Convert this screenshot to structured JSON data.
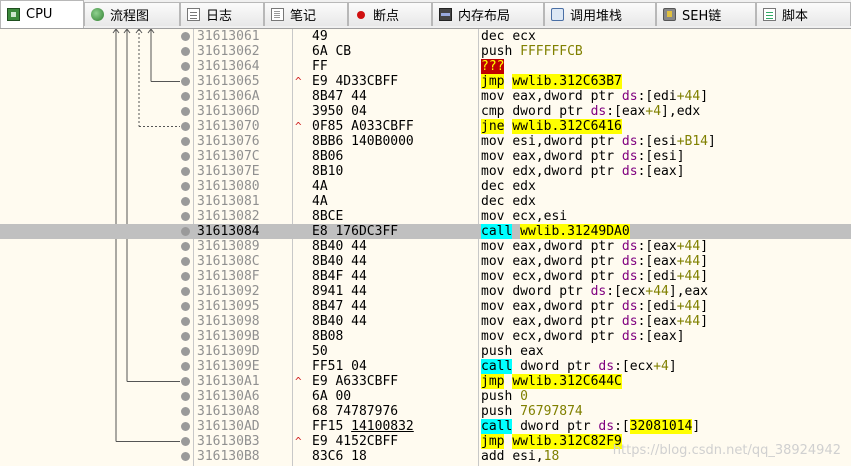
{
  "tabs": [
    {
      "label": "CPU",
      "icon": "cpu-icon",
      "active": true
    },
    {
      "label": "流程图",
      "icon": "flowchart-icon"
    },
    {
      "label": "日志",
      "icon": "log-icon"
    },
    {
      "label": "笔记",
      "icon": "notes-icon"
    },
    {
      "label": "断点",
      "icon": "breakpoint-icon"
    },
    {
      "label": "内存布局",
      "icon": "memory-map-icon"
    },
    {
      "label": "调用堆栈",
      "icon": "call-stack-icon"
    },
    {
      "label": "SEH链",
      "icon": "seh-chain-icon"
    },
    {
      "label": "脚本",
      "icon": "script-icon"
    }
  ],
  "rows": [
    {
      "addr": "31613061",
      "bytes": "49",
      "dis": [
        {
          "t": "dec ",
          "c": "mn"
        },
        {
          "t": "ecx",
          "c": "reg"
        }
      ]
    },
    {
      "addr": "31613062",
      "bytes": "6A CB",
      "dis": [
        {
          "t": "push ",
          "c": "mn"
        },
        {
          "t": "FFFFFFCB",
          "c": "num"
        }
      ]
    },
    {
      "addr": "31613064",
      "bytes": "FF",
      "dis": [
        {
          "t": "???",
          "c": "hl-r"
        }
      ]
    },
    {
      "addr": "31613065",
      "bytes": "E9 4D33CBFF",
      "mark": "^",
      "dis": [
        {
          "t": "jmp",
          "c": "hl-y"
        },
        {
          "t": " ",
          "c": ""
        },
        {
          "t": "wwlib.312C63B7",
          "c": "hl-y"
        }
      ]
    },
    {
      "addr": "3161306A",
      "bytes": "8B47 44",
      "dis": [
        {
          "t": "mov ",
          "c": "mn"
        },
        {
          "t": "eax",
          "c": "reg"
        },
        {
          "t": ",",
          "c": ""
        },
        {
          "t": "dword ptr ",
          "c": "kw"
        },
        {
          "t": "ds",
          "c": "seg"
        },
        {
          "t": ":[",
          "c": ""
        },
        {
          "t": "edi",
          "c": "reg"
        },
        {
          "t": "+44",
          "c": "num"
        },
        {
          "t": "]",
          "c": ""
        }
      ]
    },
    {
      "addr": "3161306D",
      "bytes": "3950 04",
      "dis": [
        {
          "t": "cmp ",
          "c": "mn"
        },
        {
          "t": "dword ptr ",
          "c": "kw"
        },
        {
          "t": "ds",
          "c": "seg"
        },
        {
          "t": ":[",
          "c": ""
        },
        {
          "t": "eax",
          "c": "reg"
        },
        {
          "t": "+4",
          "c": "num"
        },
        {
          "t": "],",
          "c": ""
        },
        {
          "t": "edx",
          "c": "reg"
        }
      ]
    },
    {
      "addr": "31613070",
      "bytes": "0F85 A033CBFF",
      "mark": "^",
      "dis": [
        {
          "t": "jne",
          "c": "hl-y"
        },
        {
          "t": " ",
          "c": ""
        },
        {
          "t": "wwlib.312C6416",
          "c": "hl-y"
        }
      ]
    },
    {
      "addr": "31613076",
      "bytes": "8BB6 140B0000",
      "dis": [
        {
          "t": "mov ",
          "c": "mn"
        },
        {
          "t": "esi",
          "c": "reg"
        },
        {
          "t": ",",
          "c": ""
        },
        {
          "t": "dword ptr ",
          "c": "kw"
        },
        {
          "t": "ds",
          "c": "seg"
        },
        {
          "t": ":[",
          "c": ""
        },
        {
          "t": "esi",
          "c": "reg"
        },
        {
          "t": "+B14",
          "c": "num"
        },
        {
          "t": "]",
          "c": ""
        }
      ]
    },
    {
      "addr": "3161307C",
      "bytes": "8B06",
      "dis": [
        {
          "t": "mov ",
          "c": "mn"
        },
        {
          "t": "eax",
          "c": "reg"
        },
        {
          "t": ",",
          "c": ""
        },
        {
          "t": "dword ptr ",
          "c": "kw"
        },
        {
          "t": "ds",
          "c": "seg"
        },
        {
          "t": ":[",
          "c": ""
        },
        {
          "t": "esi",
          "c": "reg"
        },
        {
          "t": "]",
          "c": ""
        }
      ]
    },
    {
      "addr": "3161307E",
      "bytes": "8B10",
      "dis": [
        {
          "t": "mov ",
          "c": "mn"
        },
        {
          "t": "edx",
          "c": "reg"
        },
        {
          "t": ",",
          "c": ""
        },
        {
          "t": "dword ptr ",
          "c": "kw"
        },
        {
          "t": "ds",
          "c": "seg"
        },
        {
          "t": ":[",
          "c": ""
        },
        {
          "t": "eax",
          "c": "reg"
        },
        {
          "t": "]",
          "c": ""
        }
      ]
    },
    {
      "addr": "31613080",
      "bytes": "4A",
      "dis": [
        {
          "t": "dec ",
          "c": "mn"
        },
        {
          "t": "edx",
          "c": "reg"
        }
      ]
    },
    {
      "addr": "31613081",
      "bytes": "4A",
      "dis": [
        {
          "t": "dec ",
          "c": "mn"
        },
        {
          "t": "edx",
          "c": "reg"
        }
      ]
    },
    {
      "addr": "31613082",
      "bytes": "8BCE",
      "dis": [
        {
          "t": "mov ",
          "c": "mn"
        },
        {
          "t": "ecx",
          "c": "reg"
        },
        {
          "t": ",",
          "c": ""
        },
        {
          "t": "esi",
          "c": "reg"
        }
      ]
    },
    {
      "addr": "31613084",
      "bytes": "E8 176DC3FF",
      "selected": true,
      "dis": [
        {
          "t": "call",
          "c": "hl-c"
        },
        {
          "t": " ",
          "c": ""
        },
        {
          "t": "wwlib.31249DA0",
          "c": "hl-y"
        }
      ]
    },
    {
      "addr": "31613089",
      "bytes": "8B40 44",
      "dis": [
        {
          "t": "mov ",
          "c": "mn"
        },
        {
          "t": "eax",
          "c": "reg"
        },
        {
          "t": ",",
          "c": ""
        },
        {
          "t": "dword ptr ",
          "c": "kw"
        },
        {
          "t": "ds",
          "c": "seg"
        },
        {
          "t": ":[",
          "c": ""
        },
        {
          "t": "eax",
          "c": "reg"
        },
        {
          "t": "+44",
          "c": "num"
        },
        {
          "t": "]",
          "c": ""
        }
      ]
    },
    {
      "addr": "3161308C",
      "bytes": "8B40 44",
      "dis": [
        {
          "t": "mov ",
          "c": "mn"
        },
        {
          "t": "eax",
          "c": "reg"
        },
        {
          "t": ",",
          "c": ""
        },
        {
          "t": "dword ptr ",
          "c": "kw"
        },
        {
          "t": "ds",
          "c": "seg"
        },
        {
          "t": ":[",
          "c": ""
        },
        {
          "t": "eax",
          "c": "reg"
        },
        {
          "t": "+44",
          "c": "num"
        },
        {
          "t": "]",
          "c": ""
        }
      ]
    },
    {
      "addr": "3161308F",
      "bytes": "8B4F 44",
      "dis": [
        {
          "t": "mov ",
          "c": "mn"
        },
        {
          "t": "ecx",
          "c": "reg"
        },
        {
          "t": ",",
          "c": ""
        },
        {
          "t": "dword ptr ",
          "c": "kw"
        },
        {
          "t": "ds",
          "c": "seg"
        },
        {
          "t": ":[",
          "c": ""
        },
        {
          "t": "edi",
          "c": "reg"
        },
        {
          "t": "+44",
          "c": "num"
        },
        {
          "t": "]",
          "c": ""
        }
      ]
    },
    {
      "addr": "31613092",
      "bytes": "8941 44",
      "dis": [
        {
          "t": "mov ",
          "c": "mn"
        },
        {
          "t": "dword ptr ",
          "c": "kw"
        },
        {
          "t": "ds",
          "c": "seg"
        },
        {
          "t": ":[",
          "c": ""
        },
        {
          "t": "ecx",
          "c": "reg"
        },
        {
          "t": "+44",
          "c": "num"
        },
        {
          "t": "],",
          "c": ""
        },
        {
          "t": "eax",
          "c": "reg"
        }
      ]
    },
    {
      "addr": "31613095",
      "bytes": "8B47 44",
      "dis": [
        {
          "t": "mov ",
          "c": "mn"
        },
        {
          "t": "eax",
          "c": "reg"
        },
        {
          "t": ",",
          "c": ""
        },
        {
          "t": "dword ptr ",
          "c": "kw"
        },
        {
          "t": "ds",
          "c": "seg"
        },
        {
          "t": ":[",
          "c": ""
        },
        {
          "t": "edi",
          "c": "reg"
        },
        {
          "t": "+44",
          "c": "num"
        },
        {
          "t": "]",
          "c": ""
        }
      ]
    },
    {
      "addr": "31613098",
      "bytes": "8B40 44",
      "dis": [
        {
          "t": "mov ",
          "c": "mn"
        },
        {
          "t": "eax",
          "c": "reg"
        },
        {
          "t": ",",
          "c": ""
        },
        {
          "t": "dword ptr ",
          "c": "kw"
        },
        {
          "t": "ds",
          "c": "seg"
        },
        {
          "t": ":[",
          "c": ""
        },
        {
          "t": "eax",
          "c": "reg"
        },
        {
          "t": "+44",
          "c": "num"
        },
        {
          "t": "]",
          "c": ""
        }
      ]
    },
    {
      "addr": "3161309B",
      "bytes": "8B08",
      "dis": [
        {
          "t": "mov ",
          "c": "mn"
        },
        {
          "t": "ecx",
          "c": "reg"
        },
        {
          "t": ",",
          "c": ""
        },
        {
          "t": "dword ptr ",
          "c": "kw"
        },
        {
          "t": "ds",
          "c": "seg"
        },
        {
          "t": ":[",
          "c": ""
        },
        {
          "t": "eax",
          "c": "reg"
        },
        {
          "t": "]",
          "c": ""
        }
      ]
    },
    {
      "addr": "3161309D",
      "bytes": "50",
      "dis": [
        {
          "t": "push ",
          "c": "mn"
        },
        {
          "t": "eax",
          "c": "reg"
        }
      ]
    },
    {
      "addr": "3161309E",
      "bytes": "FF51 04",
      "dis": [
        {
          "t": "call",
          "c": "hl-c"
        },
        {
          "t": " ",
          "c": ""
        },
        {
          "t": "dword ptr ",
          "c": "kw"
        },
        {
          "t": "ds",
          "c": "seg"
        },
        {
          "t": ":[",
          "c": ""
        },
        {
          "t": "ecx",
          "c": "reg"
        },
        {
          "t": "+4",
          "c": "num"
        },
        {
          "t": "]",
          "c": ""
        }
      ]
    },
    {
      "addr": "316130A1",
      "bytes": "E9 A633CBFF",
      "mark": "^",
      "dis": [
        {
          "t": "jmp",
          "c": "hl-y"
        },
        {
          "t": " ",
          "c": ""
        },
        {
          "t": "wwlib.312C644C",
          "c": "hl-y"
        }
      ]
    },
    {
      "addr": "316130A6",
      "bytes": "6A 00",
      "dis": [
        {
          "t": "push ",
          "c": "mn"
        },
        {
          "t": "0",
          "c": "num"
        }
      ]
    },
    {
      "addr": "316130A8",
      "bytes": "68 74787976",
      "dis": [
        {
          "t": "push ",
          "c": "mn"
        },
        {
          "t": "76797874",
          "c": "num"
        }
      ]
    },
    {
      "addr": "316130AD",
      "bytes": "FF15 ",
      "bytes_u": "14100832",
      "dis": [
        {
          "t": "call",
          "c": "hl-c"
        },
        {
          "t": " ",
          "c": ""
        },
        {
          "t": "dword ptr ",
          "c": "kw"
        },
        {
          "t": "ds",
          "c": "seg"
        },
        {
          "t": ":[",
          "c": ""
        },
        {
          "t": "32081014",
          "c": "mem"
        },
        {
          "t": "]",
          "c": ""
        }
      ]
    },
    {
      "addr": "316130B3",
      "bytes": "E9 4152CBFF",
      "mark": "^",
      "dis": [
        {
          "t": "jmp",
          "c": "hl-y"
        },
        {
          "t": " ",
          "c": ""
        },
        {
          "t": "wwlib.312C82F9",
          "c": "hl-y"
        }
      ]
    },
    {
      "addr": "316130B8",
      "bytes": "83C6 18",
      "dis": [
        {
          "t": "add ",
          "c": "mn"
        },
        {
          "t": "esi",
          "c": "reg"
        },
        {
          "t": ",",
          "c": ""
        },
        {
          "t": "18",
          "c": "num"
        }
      ]
    }
  ],
  "watermark": "https://blog.csdn.net/qq_38924942"
}
